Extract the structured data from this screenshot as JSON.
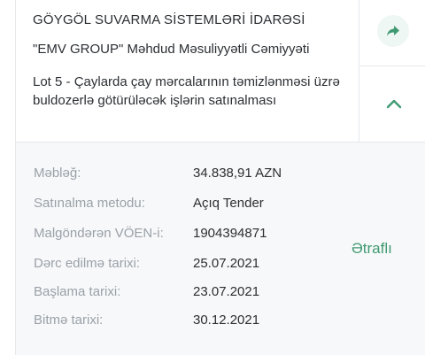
{
  "tender": {
    "organization": "GÖYGÖL SUVARMA SİSTEMLƏRİ İDARƏSİ",
    "supplier": "\"EMV GROUP\" Məhdud Məsuliyyətli Cəmiyyəti",
    "title": "Lot 5 - Çaylarda çay mərcalarının təmizlənməsi üzrə buldozerlə götürüləcək işlərin satınalması"
  },
  "details": {
    "amount": {
      "label": "Məbləğ:",
      "value": "34.838,91 AZN"
    },
    "method": {
      "label": "Satınalma metodu:",
      "value": "Açıq Tender"
    },
    "voen": {
      "label": "Malgöndərən VÖEN-i:",
      "value": "1904394871"
    },
    "published": {
      "label": "Dərc edilmə tarixi:",
      "value": "25.07.2021"
    },
    "start": {
      "label": "Başlama tarixi:",
      "value": "23.07.2021"
    },
    "end": {
      "label": "Bitmə tarixi:",
      "value": "30.12.2021"
    }
  },
  "actions": {
    "more_label": "Ətraflı",
    "share_icon": "share-arrow-icon",
    "collapse_icon": "chevron-up-icon"
  },
  "colors": {
    "accent": "#3f9a72",
    "label": "#9aa1a8",
    "text": "#2b2f33",
    "details_bg": "#f7f8f9"
  }
}
